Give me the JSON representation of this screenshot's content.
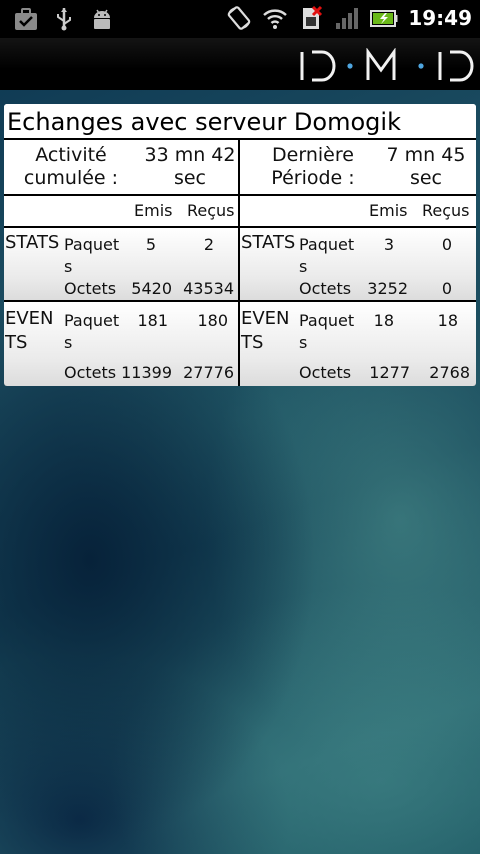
{
  "status_bar": {
    "time": "19:49",
    "icons": [
      "briefcase-icon",
      "usb-icon",
      "android-debug-icon",
      "screen-rotate-icon",
      "wifi-icon",
      "no-sim-icon",
      "signal-icon",
      "battery-charging-icon"
    ]
  },
  "app": {
    "logo_text": "D·M·D"
  },
  "panel": {
    "title": "Echanges avec serveur Domogik",
    "left": {
      "time_label_1": "Activité",
      "time_label_2": "cumulée :",
      "time_value_1": "33 mn 42",
      "time_value_2": "sec",
      "col_emis": "Emis",
      "col_recus": "Reçus",
      "stats": {
        "group_label": "STATS",
        "paquets_label_1": "Paquet",
        "paquets_label_2": "s",
        "paquets_emis": "5",
        "paquets_recus": "2",
        "octets_label": "Octets",
        "octets_emis": "5420",
        "octets_recus": "43534"
      },
      "events": {
        "group_label_1": "EVEN",
        "group_label_2": "TS",
        "paquets_label_1": "Paquet",
        "paquets_label_2": "s",
        "paquets_emis": "181",
        "paquets_recus": "180",
        "octets_label": "Octets",
        "octets_emis": "11399",
        "octets_recus": "27776"
      }
    },
    "right": {
      "time_label_1": "Dernière",
      "time_label_2": "Période :",
      "time_value_1": "7 mn 45",
      "time_value_2": "sec",
      "col_emis": "Emis",
      "col_recus": "Reçus",
      "stats": {
        "group_label": "STATS",
        "paquets_label_1": "Paquet",
        "paquets_label_2": "s",
        "paquets_emis": "3",
        "paquets_recus": "0",
        "octets_label": "Octets",
        "octets_emis": "3252",
        "octets_recus": "0"
      },
      "events": {
        "group_label_1": "EVEN",
        "group_label_2": "TS",
        "paquets_label_1": "Paquet",
        "paquets_label_2": "s",
        "paquets_emis": "18",
        "paquets_recus": "18",
        "octets_label": "Octets",
        "octets_emis": "1277",
        "octets_recus": "2768"
      }
    }
  }
}
